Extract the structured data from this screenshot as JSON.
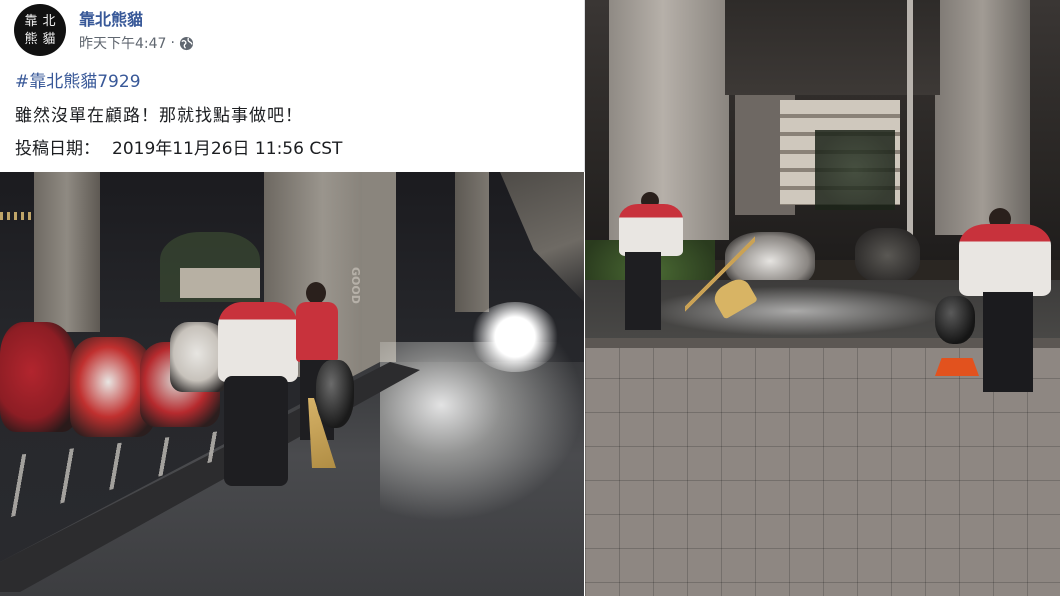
{
  "post": {
    "avatar_chars": [
      "靠",
      "北",
      "熊",
      "貓"
    ],
    "page_name": "靠北熊貓",
    "timestamp": "昨天下午4:47",
    "separator": "·",
    "privacy_icon": "globe-icon",
    "hashtag": "#靠北熊貓7929",
    "body_text": "雖然沒單在顧路！那就找點事做吧！",
    "date_label": "投稿日期：",
    "date_value": "2019年11月26日 11:56 CST"
  },
  "photos": {
    "left_graffiti": "GOOD",
    "colors": {
      "link": "#385898",
      "meta": "#606770",
      "text": "#1c1e21",
      "jacket_red": "#c8323c",
      "jacket_white": "#e9e6e2"
    }
  }
}
